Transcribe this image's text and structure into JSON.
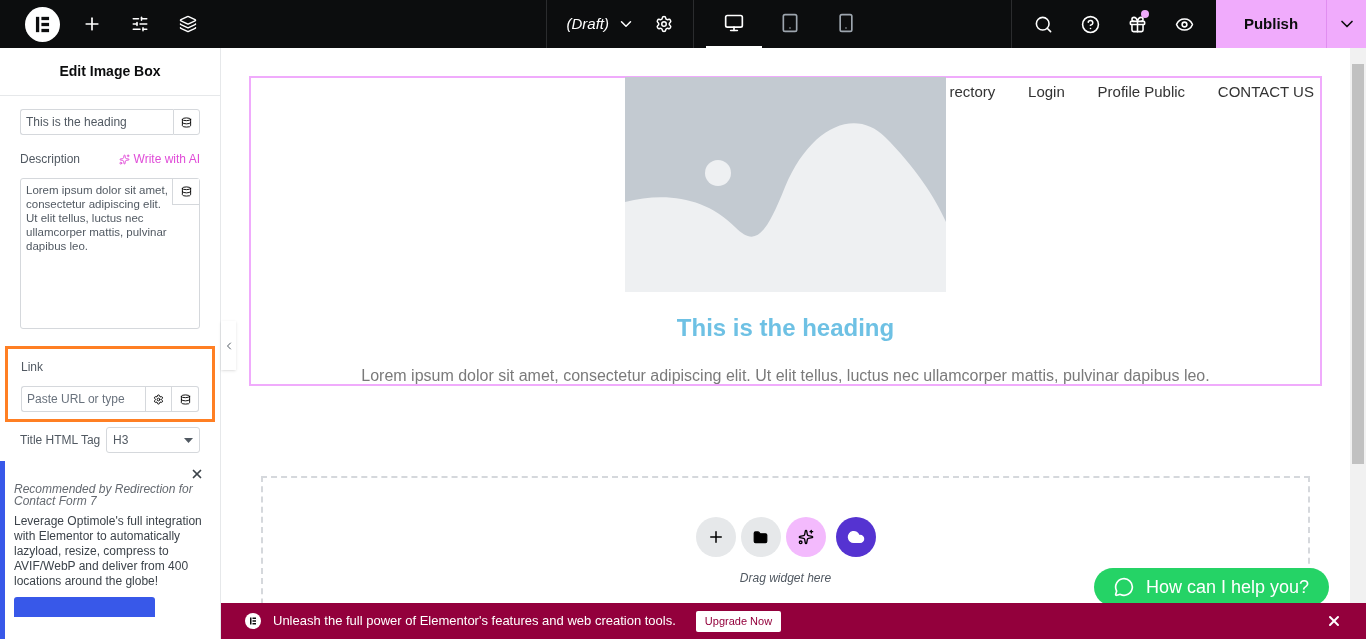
{
  "topbar": {
    "document": "(Draft)",
    "devices": [
      {
        "kind": "desktop",
        "selected": true
      },
      {
        "kind": "tablet",
        "selected": false
      },
      {
        "kind": "mobile",
        "selected": false
      }
    ],
    "gift_badge": true,
    "publish": "Publish"
  },
  "panel": {
    "title": "Edit Image Box",
    "heading_field": {
      "value": "This is the heading"
    },
    "description": {
      "label": "Description",
      "ai_link": "Write with AI",
      "value": "Lorem ipsum dolor sit amet, consectetur adipiscing elit. Ut elit tellus, luctus nec ullamcorper mattis, pulvinar dapibus leo."
    },
    "link": {
      "label": "Link",
      "placeholder": "Paste URL or type",
      "highlighted": true
    },
    "title_tag": {
      "label": "Title HTML Tag",
      "value": "H3"
    }
  },
  "promo": {
    "source": "Recommended by Redirection for Contact Form 7",
    "text": "Leverage Optimole's full integration with Elementor to automatically lazyload, resize, compress to AVIF/WebP and deliver from 400 locations around the globe!"
  },
  "canvas": {
    "nav": [
      "rectory",
      "Login",
      "Profile Public",
      "CONTACT US"
    ],
    "heading": "This is the heading",
    "description": "Lorem ipsum dolor sit amet, consectetur adipiscing elit. Ut elit tellus, luctus nec ullamcorper mattis, pulvinar dapibus leo.",
    "dropzone": {
      "hint": "Drag widget here"
    },
    "chat_button": "How can I help you?"
  },
  "banner": {
    "text": "Unleash the full power of Elementor's features and web creation tools.",
    "button": "Upgrade Now"
  }
}
